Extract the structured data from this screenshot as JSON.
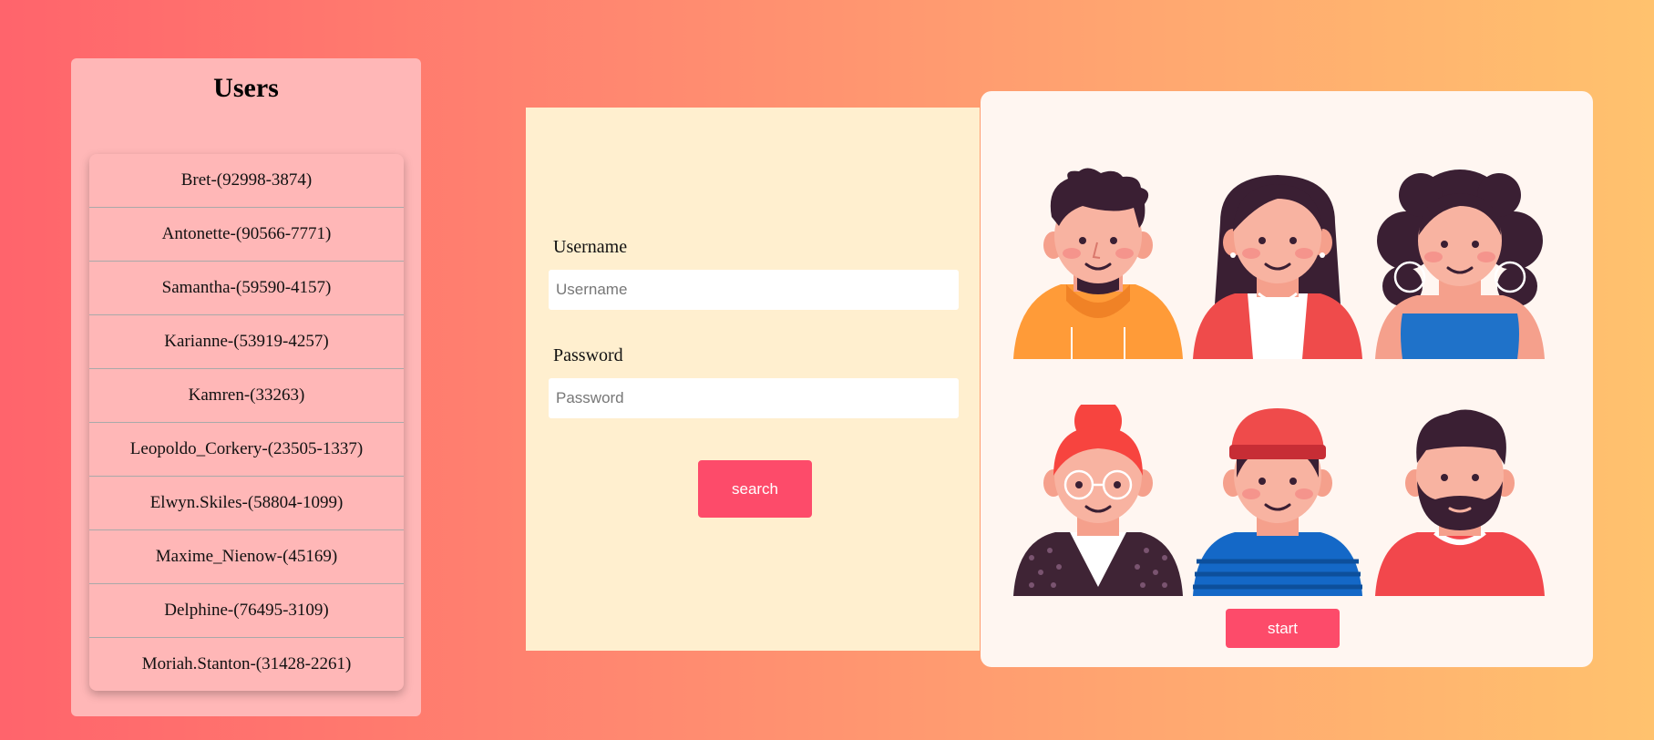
{
  "sidebar": {
    "title": "Users",
    "users": [
      "Bret-(92998-3874)",
      "Antonette-(90566-7771)",
      "Samantha-(59590-4157)",
      "Karianne-(53919-4257)",
      "Kamren-(33263)",
      "Leopoldo_Corkery-(23505-1337)",
      "Elwyn.Skiles-(58804-1099)",
      "Maxime_Nienow-(45169)",
      "Delphine-(76495-3109)",
      "Moriah.Stanton-(31428-2261)"
    ]
  },
  "login": {
    "username_label": "Username",
    "username_placeholder": "Username",
    "password_label": "Password",
    "password_placeholder": "Password",
    "search_label": "search"
  },
  "avatars": {
    "start_label": "start",
    "items": [
      {
        "name": "man-orange-hoodie-avatar"
      },
      {
        "name": "woman-red-top-avatar"
      },
      {
        "name": "woman-curly-hair-avatar"
      },
      {
        "name": "woman-glasses-bun-avatar"
      },
      {
        "name": "man-red-beanie-avatar"
      },
      {
        "name": "man-beard-avatar"
      }
    ]
  }
}
